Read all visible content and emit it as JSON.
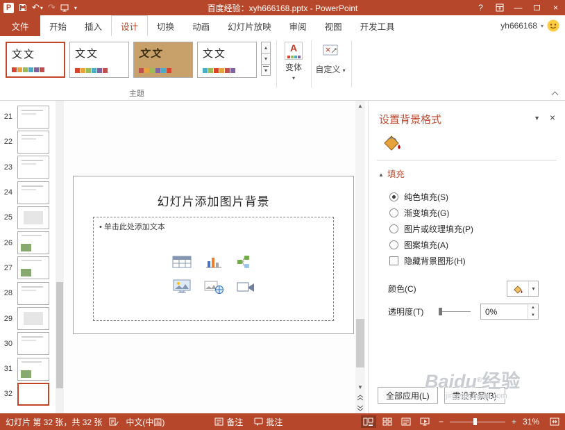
{
  "colors": {
    "accent": "#B7472A",
    "selection_border": "#C34527",
    "pane_title": "#BE4B30"
  },
  "glyphs": {
    "logo_letter": "P",
    "undo": "↶",
    "redo": "↷",
    "dropdown": "▾",
    "help": "?",
    "minimize": "—",
    "close": "×",
    "gallery_up": "▴",
    "gallery_down": "▾",
    "variant_letter": "A",
    "bullet": "•",
    "pane_collapse": "▼",
    "pane_close": "×",
    "section_triangle": "▲",
    "spin_up": "▲",
    "spin_down": "▼",
    "scroll_up": "▲",
    "scroll_down": "▼",
    "minus": "−",
    "plus": "+"
  },
  "title_bar": {
    "title": "百度经验：xyh666168.pptx - PowerPoint"
  },
  "file_tab": "文件",
  "ribbon_tabs": [
    "开始",
    "插入",
    "设计",
    "切换",
    "动画",
    "幻灯片放映",
    "审阅",
    "视图",
    "开发工具"
  ],
  "selected_tab": "设计",
  "account_name": "yh666168",
  "ribbon": {
    "group_label": "主题",
    "theme_text": "文文",
    "variants_label": "变体",
    "customize_label": "自定义"
  },
  "slides": {
    "items": [
      "21",
      "22",
      "23",
      "24",
      "25",
      "26",
      "27",
      "28",
      "29",
      "30",
      "31",
      "32"
    ],
    "selected": "32"
  },
  "slide": {
    "title": "幻灯片添加图片背景",
    "placeholder": "单击此处添加文本"
  },
  "task_pane": {
    "title": "设置背景格式",
    "section": "填充",
    "options": [
      {
        "label": "纯色填充(S)",
        "control": "radio",
        "checked": true
      },
      {
        "label": "渐变填充(G)",
        "control": "radio",
        "checked": false
      },
      {
        "label": "图片或纹理填充(P)",
        "control": "radio",
        "checked": false
      },
      {
        "label": "图案填充(A)",
        "control": "radio",
        "checked": false
      },
      {
        "label": "隐藏背景图形(H)",
        "control": "checkbox",
        "checked": false
      }
    ],
    "color_label": "颜色(C)",
    "transparency_label": "透明度(T)",
    "transparency_value": "0%",
    "apply_all_button": "全部应用(L)",
    "reset_button": "重设背景(B)"
  },
  "watermark": {
    "logo": "Baidu",
    "reg": "®",
    "suffix": "经验",
    "url": "jingyan.baidu.com"
  },
  "status_bar": {
    "slide_info": "幻灯片 第 32 张，共 32 张",
    "language": "中文(中国)",
    "notes": "备注",
    "comments": "批注",
    "zoom": "31%"
  }
}
